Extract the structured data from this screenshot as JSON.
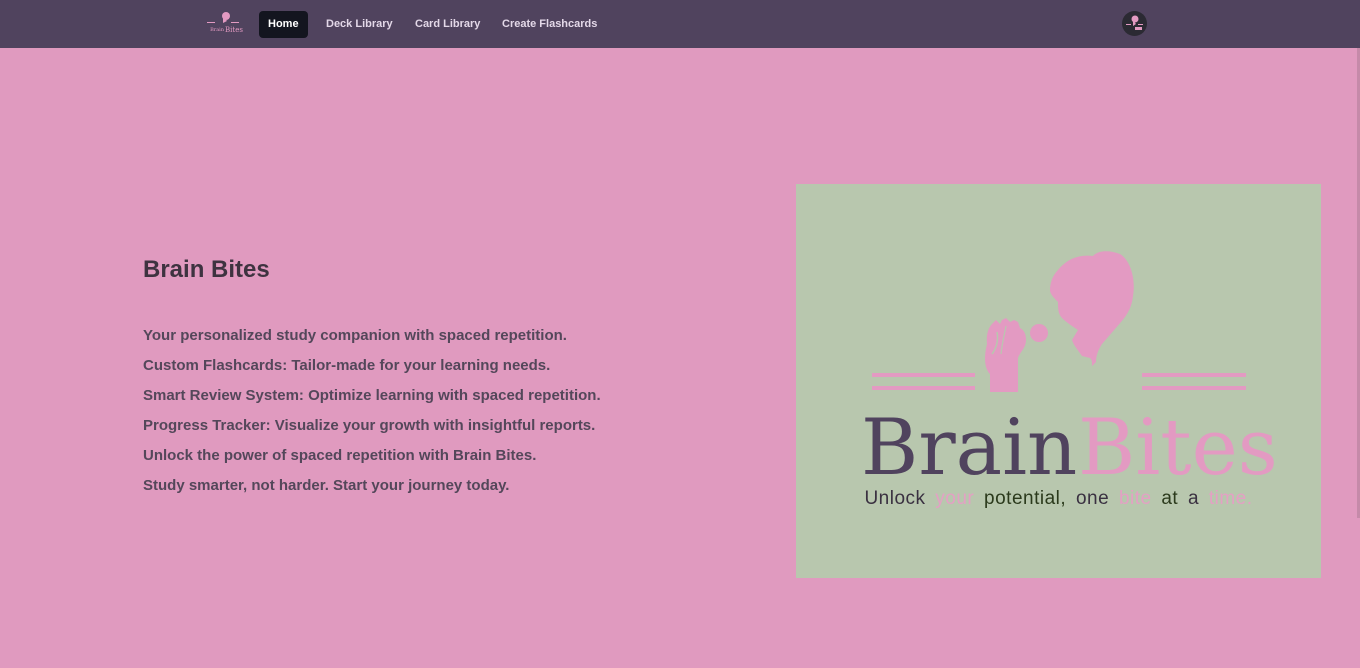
{
  "nav": {
    "logo_top": "Brain",
    "logo_bottom": "Bites",
    "items": [
      {
        "label": "Home",
        "active": true
      },
      {
        "label": "Deck Library",
        "active": false
      },
      {
        "label": "Card Library",
        "active": false
      },
      {
        "label": "Create Flashcards",
        "active": false
      }
    ]
  },
  "hero": {
    "title": "Brain Bites",
    "features": [
      "Your personalized study companion with spaced repetition.",
      "Custom Flashcards: Tailor-made for your learning needs.",
      "Smart Review System: Optimize learning with spaced repetition.",
      "Progress Tracker: Visualize your growth with insightful reports.",
      "Unlock the power of spaced repetition with Brain Bites.",
      "Study smarter, not harder. Start your journey today."
    ]
  },
  "logo": {
    "word1": "Brain",
    "word2": "Bites",
    "tagline": {
      "w1": "Unlock",
      "w2": "your",
      "w3": "potential,",
      "w4": "one",
      "w5": "bite",
      "w6": "at",
      "w7": "a",
      "w8": "time."
    }
  },
  "colors": {
    "background": "#e09abf",
    "navbar": "#50435e",
    "logo_card": "#b8c7ae",
    "brand_dark": "#50435e",
    "brand_pink": "#e39ac2"
  }
}
